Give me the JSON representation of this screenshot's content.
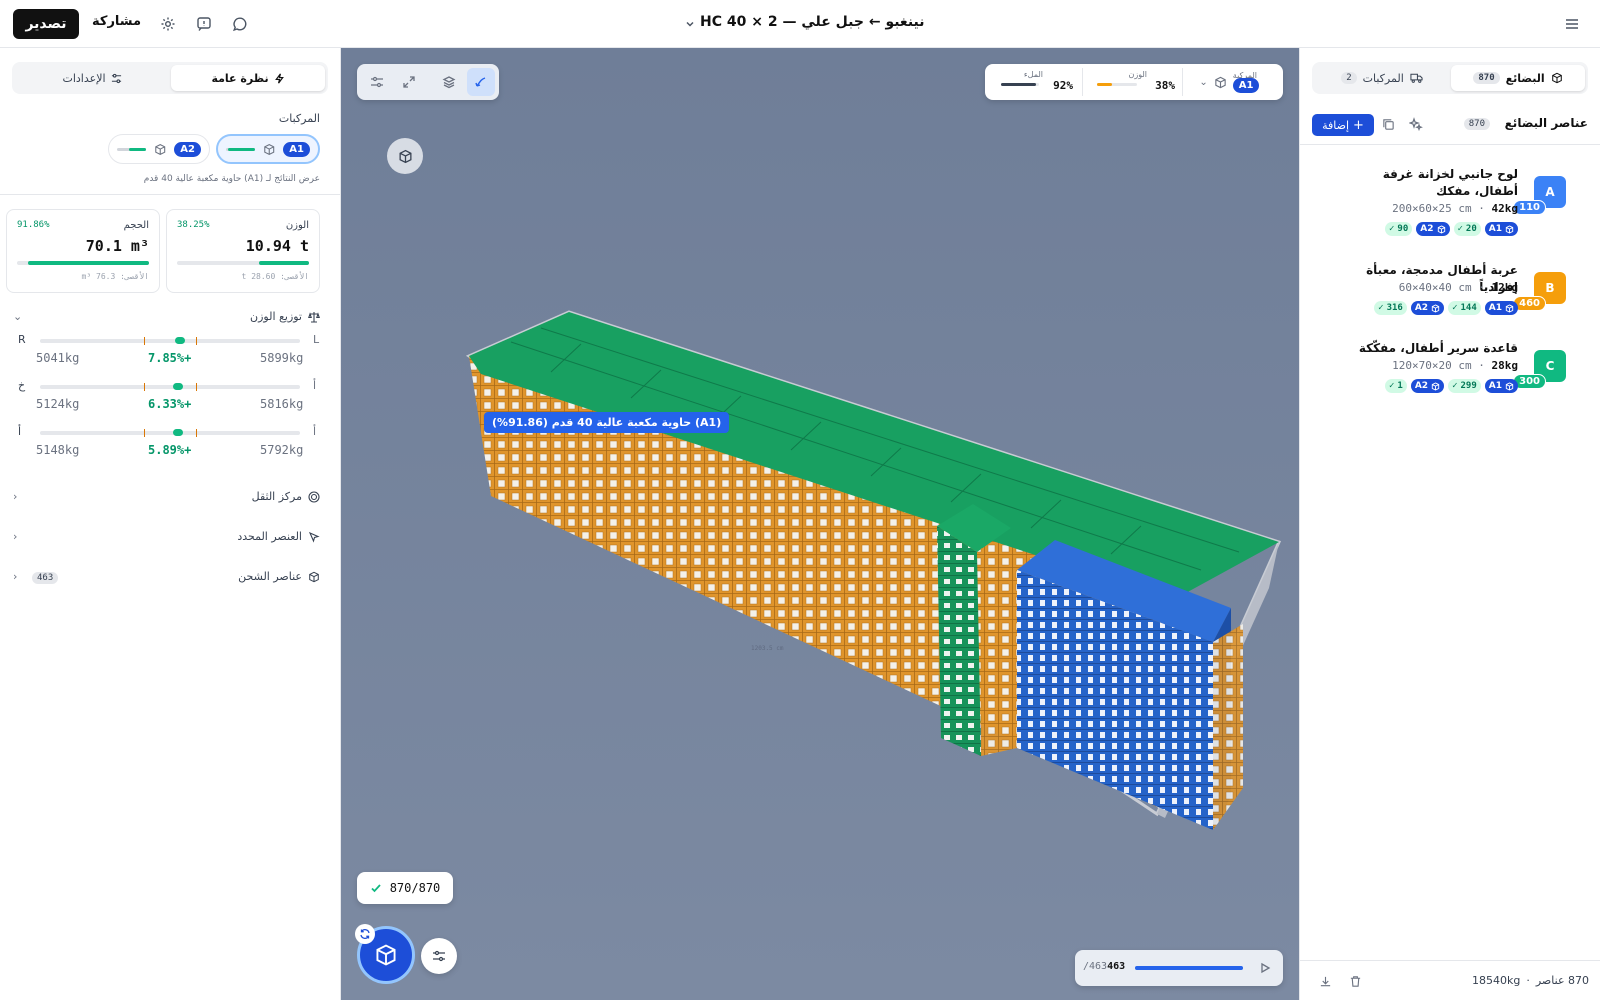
{
  "header": {
    "title": "نينغبو ← جبل علي — 2 × HC 40",
    "export_label": "تصدير",
    "share_label": "مشاركة"
  },
  "left": {
    "tabs": [
      {
        "label": "نظرة عامة",
        "active": true
      },
      {
        "label": "الإعدادات",
        "active": false
      }
    ],
    "vehicles_label": "المركبات",
    "vehicles": [
      {
        "id": "A1",
        "selected": true,
        "fill": 0.92
      },
      {
        "id": "A2",
        "selected": false,
        "fill": 0.6
      }
    ],
    "results_note": "عرض النتائج لـ (A1) حاوية مكعبة عالية 40 قدم",
    "weight_card": {
      "title": "الوزن",
      "percent": "38.25%",
      "value": "10.94 t",
      "max": "الأقصى: 28.60 t",
      "fill": 0.3825
    },
    "volume_card": {
      "title": "الحجم",
      "percent": "91.86%",
      "value": "70.1 m³",
      "max": "الأقصى: 76.3 m³",
      "fill": 0.9186
    },
    "weight_distribution": {
      "label": "توزيع الوزن",
      "rows": [
        {
          "left_label": "R",
          "right_label": "L",
          "left_kg": "5041kg",
          "pct": "7.85%+",
          "right_kg": "5899kg",
          "pos": 0.54
        },
        {
          "left_label": "خ",
          "right_label": "أ",
          "left_kg": "5124kg",
          "pct": "6.33%+",
          "right_kg": "5816kg",
          "pos": 0.53
        },
        {
          "left_label": "أ",
          "right_label": "أ",
          "left_kg": "5148kg",
          "pct": "5.89%+",
          "right_kg": "5792kg",
          "pos": 0.53
        }
      ]
    },
    "sections": [
      {
        "label": "مركز الثقل",
        "icon": "target-icon"
      },
      {
        "label": "العنصر المحدد",
        "icon": "cursor-icon"
      },
      {
        "label": "عناصر الشحن",
        "icon": "box-icon",
        "count": "463"
      }
    ]
  },
  "viewport": {
    "hud": {
      "vehicle_label": "المركبة",
      "vehicle": "A1",
      "weight_label": "الوزن",
      "weight_value": "38%",
      "weight_fill": 0.38,
      "fill_label": "الملء",
      "fill_value": "92%",
      "fill_fill": 0.92
    },
    "container_label": "(A1) حاوية مكعبة عالية 40 قدم (91.86%)",
    "status": "870/870",
    "player": {
      "current": "463",
      "total": "/463",
      "progress": 1.0
    }
  },
  "right": {
    "tabs": [
      {
        "label": "البضائع",
        "count": "870",
        "active": true
      },
      {
        "label": "المركبات",
        "count": "2",
        "active": false
      }
    ],
    "section_title": "عناصر البضائع",
    "section_count": "870",
    "add_label": "إضافة",
    "items": [
      {
        "letter": "A",
        "color": "#3b82f6",
        "qty": "110",
        "name": "لوح جانبي لخزانة غرفة أطفال، مفكك",
        "weight": "42kg",
        "dims": "200×60×25 cm",
        "a1_count": "20",
        "a2_count": "90"
      },
      {
        "letter": "B",
        "color": "#f59e0b",
        "qty": "460",
        "name": "عربة أطفال مدمجة، معبأة إفرادياً",
        "weight": "12kg",
        "dims": "60×40×40 cm",
        "a1_count": "144",
        "a2_count": "316"
      },
      {
        "letter": "C",
        "color": "#10b981",
        "qty": "300",
        "name": "قاعدة سرير أطفال، مفكّكة",
        "weight": "28kg",
        "dims": "120×70×20 cm",
        "a1_count": "299",
        "a2_count": "1"
      }
    ],
    "footer": {
      "count": "870 عناصر",
      "sep": "·",
      "weight": "18540kg"
    }
  }
}
